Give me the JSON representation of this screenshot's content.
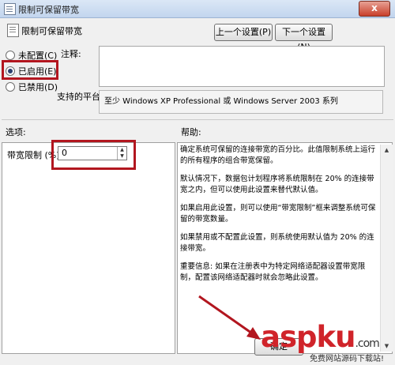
{
  "window": {
    "title": "限制可保留带宽",
    "close_label": "x"
  },
  "header": {
    "title": "限制可保留带宽"
  },
  "nav": {
    "prev_label": "上一个设置(P)",
    "next_label": "下一个设置(N)"
  },
  "options": [
    {
      "label": "未配置(C)",
      "checked": false
    },
    {
      "label": "已启用(E)",
      "checked": true
    },
    {
      "label": "已禁用(D)",
      "checked": false
    }
  ],
  "comment": {
    "label": "注释:",
    "value": ""
  },
  "platform": {
    "label": "支持的平台:",
    "value": "至少 Windows XP Professional 或 Windows Server 2003 系列"
  },
  "sections": {
    "options_label": "选项:",
    "help_label": "帮助:"
  },
  "bandwidth": {
    "label": "带宽限制 (%):",
    "value": "0"
  },
  "help_paragraphs": [
    "确定系统可保留的连接带宽的百分比。此值限制系统上运行的所有程序的组合带宽保留。",
    "默认情况下，数据包计划程序将系统限制在 20% 的连接带宽之内，但可以使用此设置来替代默认值。",
    "如果启用此设置，则可以使用“带宽限制”框来调整系统可保留的带宽数量。",
    "如果禁用或不配置此设置，则系统使用默认值为 20% 的连接带宽。",
    "重要信息: 如果在注册表中为特定网络适配器设置带宽限制，配置该网络适配器时就会忽略此设置。"
  ],
  "footer": {
    "ok_label": "确定"
  },
  "watermark": {
    "text": "aspku",
    "suffix": ".com",
    "subtitle": "免费网站源码下载站!"
  },
  "colors": {
    "highlight": "#b2161f",
    "watermark": "#d0242a"
  }
}
